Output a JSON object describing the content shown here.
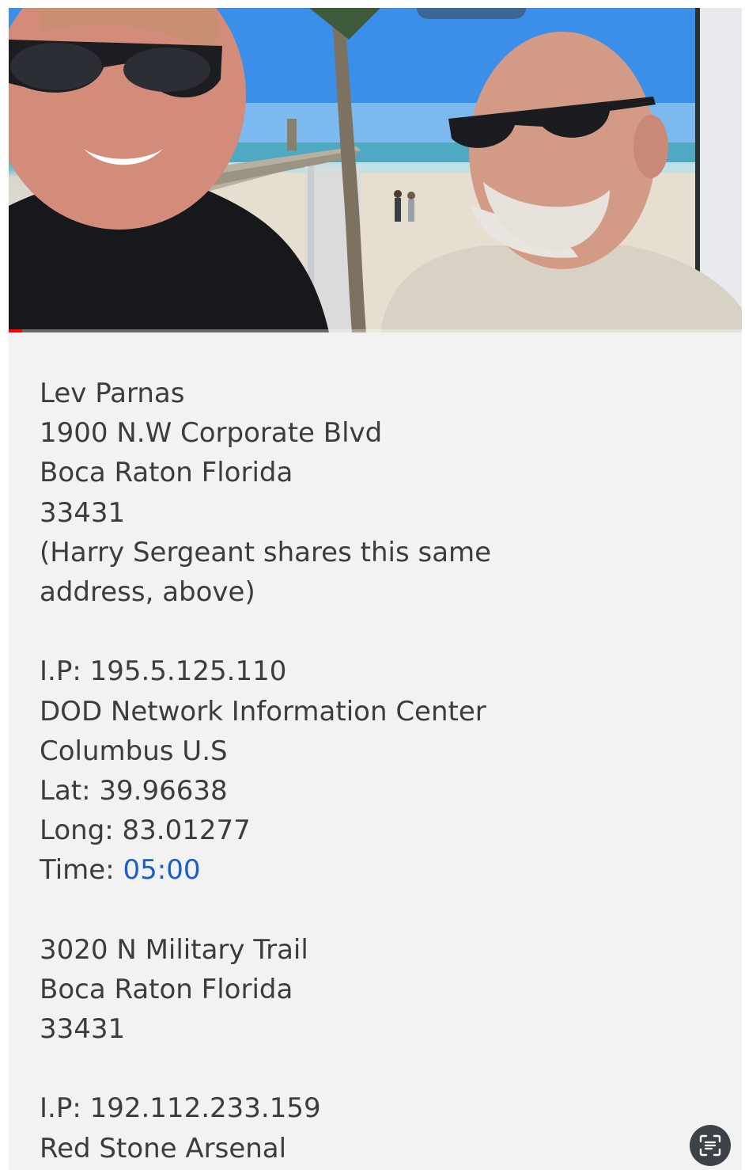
{
  "video": {
    "progress_fraction": 0.018,
    "scene_icon": "beach-pier-video-frame-icon"
  },
  "caption": {
    "block1": {
      "name": "Lev Parnas",
      "street": "1900 N.W Corporate Blvd",
      "city": "Boca Raton Florida",
      "zip": "33431",
      "note_line1": "(Harry Sergeant shares this same",
      "note_line2": "address, above)"
    },
    "block2": {
      "ip": "I.P: 195.5.125.110",
      "org": "DOD Network Information Center",
      "location": "Columbus U.S",
      "lat": "Lat: 39.96638",
      "long": "Long: 83.01277",
      "time_prefix": "Time: ",
      "time_value": "05:00"
    },
    "block3": {
      "street": "3020 N Military Trail",
      "city": "Boca Raton Florida",
      "zip": "33431"
    },
    "block4": {
      "ip": "I.P: 192.112.233.159",
      "org": "Red Stone Arsenal"
    }
  },
  "colors": {
    "text": "#3c3c3c",
    "link": "#1a5fc9",
    "progress": "#ff0000",
    "background": "#f2f2f2",
    "lens_button": "#3d4248"
  },
  "lens_button": {
    "icon": "scan-text-icon"
  }
}
